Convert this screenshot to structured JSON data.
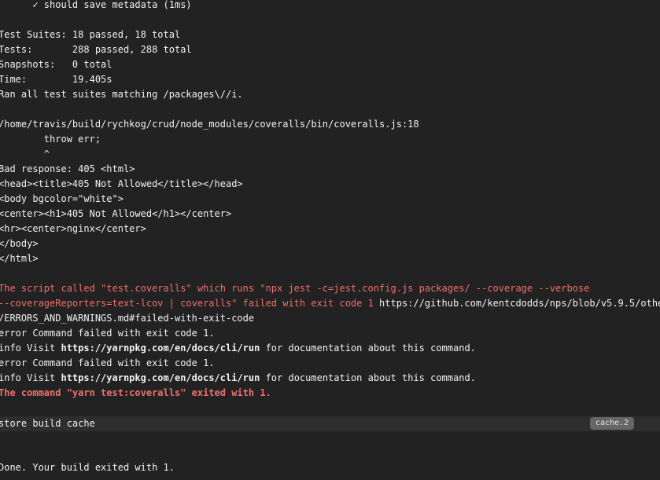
{
  "log": {
    "test_pass": "      ✓ should save metadata (1ms)",
    "suites": "Test Suites: 18 passed, 18 total",
    "tests": "Tests:       288 passed, 288 total",
    "snapshots": "Snapshots:   0 total",
    "time": "Time:        19.405s",
    "ran": "Ran all test suites matching /packages\\//i.",
    "err_path": "/home/travis/build/rychkog/crud/node_modules/coveralls/bin/coveralls.js:18",
    "throw": "        throw err;",
    "caret": "        ^",
    "bad_response": "Bad response: 405 <html>",
    "head": "<head><title>405 Not Allowed</title></head>",
    "body_open": "<body bgcolor=\"white\">",
    "center": "<center><h1>405 Not Allowed</h1></center>",
    "hr": "<hr><center>nginx</center>",
    "body_close": "</body>",
    "html_close": "</html>",
    "script_line1": "The script called \"test.coveralls\" which runs \"npx jest -c=jest.config.js packages/ --coverage --verbose",
    "script_line2_red": "--coverageReporters=text-lcov | coveralls\" failed with exit code 1",
    "script_line2_url": " https://github.com/kentcdodds/nps/blob/v5.9.5/other",
    "errors_md": "/ERRORS_AND_WARNINGS.md#failed-with-exit-code",
    "error1": "error Command failed with exit code 1.",
    "info1_prefix": "info Visit ",
    "info1_link": "https://yarnpkg.com/en/docs/cli/run",
    "info1_suffix": " for documentation about this command.",
    "error2": "error Command failed with exit code 1.",
    "info2_prefix": "info Visit ",
    "info2_link": "https://yarnpkg.com/en/docs/cli/run",
    "info2_suffix": " for documentation about this command.",
    "command_exited": "The command \"yarn test:coveralls\" exited with 1."
  },
  "fold": {
    "label": "store build cache",
    "badge": "cache.2"
  },
  "done": "Done. Your build exited with 1."
}
